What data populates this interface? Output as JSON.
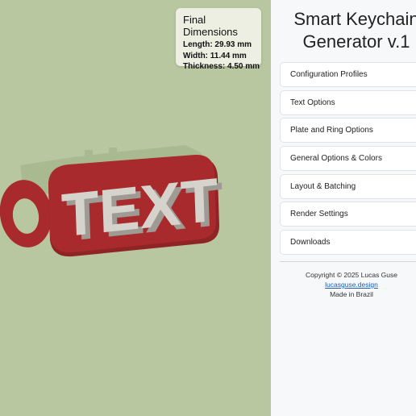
{
  "viewport": {
    "model_text": "TEXT",
    "colors": {
      "background": "#b8c79f",
      "plate": "#a82a2c",
      "plate_shadow": "#8f2426",
      "text": "#d5d3cc",
      "text_shadow": "#9e9b94",
      "back_plate": "#a8b88f"
    }
  },
  "dimensions": {
    "title": "Final Dimensions",
    "length": "Length: 29.93 mm",
    "width": "Width: 11.44 mm",
    "thickness": "Thickness: 4.50 mm"
  },
  "panel": {
    "title_line1": "Smart Keychain",
    "title_line2": "Generator v.1",
    "sections": [
      {
        "label": "Configuration Profiles"
      },
      {
        "label": "Text Options"
      },
      {
        "label": "Plate and Ring Options"
      },
      {
        "label": "General Options & Colors"
      },
      {
        "label": "Layout & Batching"
      },
      {
        "label": "Render Settings"
      },
      {
        "label": "Downloads"
      }
    ],
    "footer": {
      "copyright": "Copyright © 2025 Lucas Guse",
      "link": "lucasguse.design",
      "made_in": "Made in Brazil"
    }
  }
}
